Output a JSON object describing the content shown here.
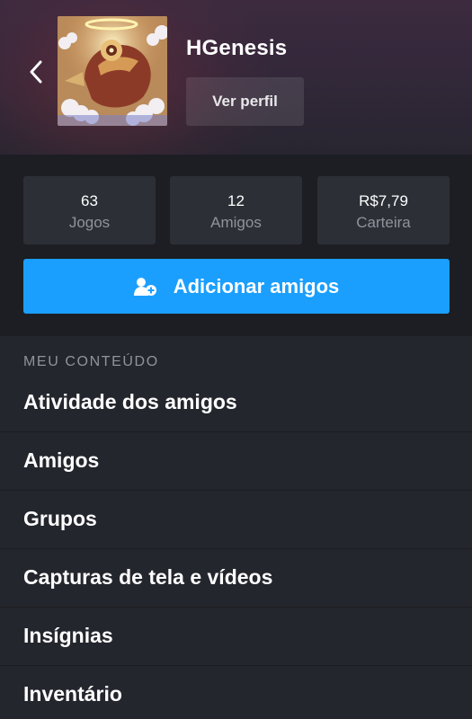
{
  "header": {
    "username": "HGenesis",
    "view_profile_label": "Ver perfil"
  },
  "stats": [
    {
      "value": "63",
      "label": "Jogos"
    },
    {
      "value": "12",
      "label": "Amigos"
    },
    {
      "value": "R$7,79",
      "label": "Carteira"
    }
  ],
  "actions": {
    "add_friends_label": "Adicionar amigos"
  },
  "menu": {
    "section_title": "MEU CONTEÚDO",
    "items": [
      {
        "label": "Atividade dos amigos"
      },
      {
        "label": "Amigos"
      },
      {
        "label": "Grupos"
      },
      {
        "label": "Capturas de tela e vídeos"
      },
      {
        "label": "Insígnias"
      },
      {
        "label": "Inventário"
      }
    ]
  },
  "icons": {
    "back": "chevron-left-icon",
    "add_friend": "add-user-icon"
  },
  "colors": {
    "accent": "#1a9fff",
    "background": "#24262d",
    "card": "#2c2f36",
    "muted_text": "#8f939c"
  }
}
